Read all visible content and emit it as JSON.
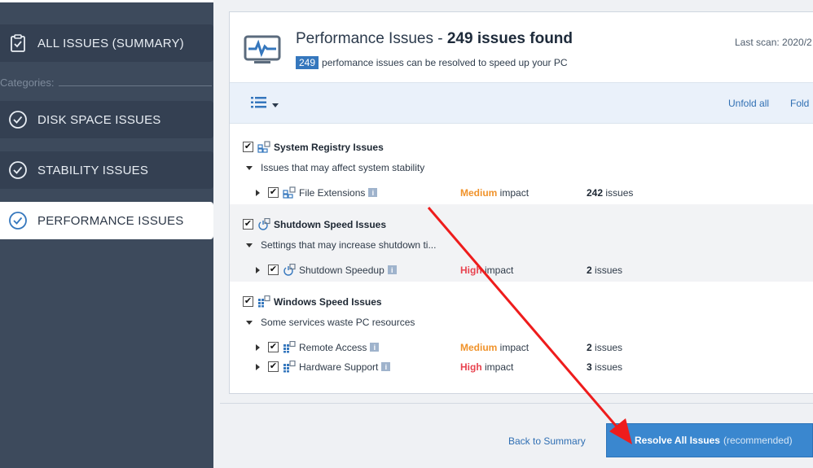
{
  "sidebar": {
    "summary_label": "ALL ISSUES (SUMMARY)",
    "categories_label": "Categories:",
    "items": [
      {
        "label": "DISK SPACE ISSUES"
      },
      {
        "label": "STABILITY ISSUES"
      },
      {
        "label": "PERFORMANCE ISSUES"
      }
    ]
  },
  "header": {
    "title_prefix": "Performance Issues - ",
    "title_bold": "249 issues found",
    "badge": "249",
    "subtitle": "perfomance issues can be resolved to speed up your PC",
    "last_scan": "Last scan: 2020/2"
  },
  "toolbar": {
    "unfold": "Unfold all",
    "fold": "Fold"
  },
  "groups": [
    {
      "title": "System Registry Issues",
      "description": "Issues that may affect system stability",
      "items": [
        {
          "name": "File Extensions",
          "impact_level": "Medium",
          "impact_word": " impact",
          "count": "242",
          "count_suffix": " issues"
        }
      ]
    },
    {
      "title": "Shutdown Speed Issues",
      "description": "Settings that may increase shutdown ti...",
      "items": [
        {
          "name": "Shutdown Speedup",
          "impact_level": "High",
          "impact_word": " impact",
          "count": "2",
          "count_suffix": " issues"
        }
      ]
    },
    {
      "title": "Windows Speed Issues",
      "description": "Some services waste PC resources",
      "items": [
        {
          "name": "Remote Access",
          "impact_level": "Medium",
          "impact_word": " impact",
          "count": "2",
          "count_suffix": " issues"
        },
        {
          "name": "Hardware Support",
          "impact_level": "High",
          "impact_word": " impact",
          "count": "3",
          "count_suffix": " issues"
        }
      ]
    }
  ],
  "footer": {
    "back": "Back to Summary",
    "resolve": "Resolve All Issues",
    "recommended": "(recommended)"
  },
  "colors": {
    "sidebar_bg": "#3d4a5c",
    "accent_blue": "#3a87cf",
    "medium": "#f0932b",
    "high": "#e8434f",
    "annotation_arrow": "#ee1c1c"
  }
}
